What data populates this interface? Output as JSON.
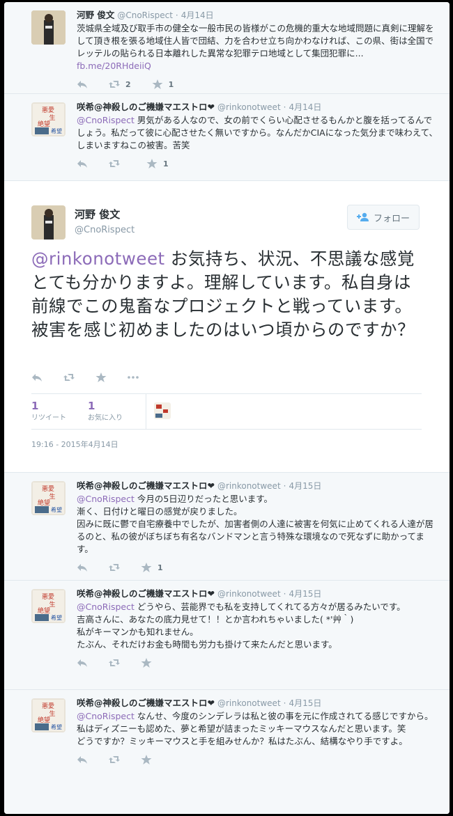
{
  "parent_tweets": [
    {
      "name": "河野 俊文",
      "handle": "@CnoRispect",
      "date": "4月14日",
      "text": "茨城県全域及び取手市の健全な一般市民の皆様がこの危機的重大な地域問題に真剣に理解をして頂き根を張る地域住人皆で団結、力を合わせ立ち向かわなければ、この県、街は全国でレッテルの貼られる日本離れした異常な犯罪テロ地域として集団犯罪に...",
      "link": "fb.me/20RHdeiiQ",
      "retweets": "2",
      "likes": "1"
    },
    {
      "name": "咲希@神殺しのご機嫌マエストロ❤",
      "handle": "@rinkonotweet",
      "date": "4月14日",
      "mention": "@CnoRispect",
      "text": " 男気がある人なので、女の前でくらい心配させるもんかと腹を括ってるんでしょう。私だって彼に心配させたく無いですから。なんだかCIAになった気分まで味わえて、しまいますねこの被害。苦笑",
      "retweets": "",
      "likes": "1"
    }
  ],
  "main_tweet": {
    "name": "河野 俊文",
    "handle": "@CnoRispect",
    "follow_label": "フォロー",
    "mention": "@rinkonotweet",
    "text": " お気持ち、状況、不思議な感覚とても分かりますよ。理解しています。私自身は前線でこの鬼畜なプロジェクトと戦っています。被害を感じ初めましたのはいつ頃からのですか？",
    "retweets_count": "1",
    "retweets_label": "リツイート",
    "likes_count": "1",
    "likes_label": "お気に入り",
    "timestamp": "19:16 - 2015年4月14日"
  },
  "replies": [
    {
      "name": "咲希@神殺しのご機嫌マエストロ❤",
      "handle": "@rinkonotweet",
      "date": "4月15日",
      "mention": "@CnoRispect",
      "lines": [
        " 今月の5日辺りだったと思います。",
        "漸く、日付けと曜日の感覚が戻りました。",
        "因みに既に鬱で自宅療養中でしたが、加害者側の人達に被害を何気に止めてくれる人達が居るのと、私の彼がぼちぼち有名なバンドマンと言う特殊な環境なので死なずに助かってます。"
      ],
      "likes": "1"
    },
    {
      "name": "咲希@神殺しのご機嫌マエストロ❤",
      "handle": "@rinkonotweet",
      "date": "4月15日",
      "mention": "@CnoRispect",
      "lines": [
        " どうやら、芸能界でも私を支持してくれてる方々が居るみたいです。",
        "吉高さんに、あなたの底力見せて！！とか言われちゃいました( *'艸｀)",
        "私がキーマンかも知れません。",
        "たぶん、それだけお金も時間も労力も掛けて来たんだと思います。"
      ],
      "likes": ""
    },
    {
      "name": "咲希@神殺しのご機嫌マエストロ❤",
      "handle": "@rinkonotweet",
      "date": "4月15日",
      "mention": "@CnoRispect",
      "lines": [
        " なんせ、今度のシンデレラは私と彼の事を元に作成されてる感じですから。",
        "私はディズニーも認めた、夢と希望が詰まったミッキーマウスなんだと思います。笑",
        "どうですか？ミッキーマウスと手を組みせんか？私はたぶん、結構なやり手ですよ。"
      ],
      "likes": ""
    }
  ],
  "avatar_text": {
    "line1": "悪愛",
    "line2": "生",
    "line3": "絶望",
    "line4": "希望"
  },
  "icons": [
    "reply-icon",
    "retweet-icon",
    "like-icon",
    "more-icon",
    "follow-user-icon"
  ]
}
